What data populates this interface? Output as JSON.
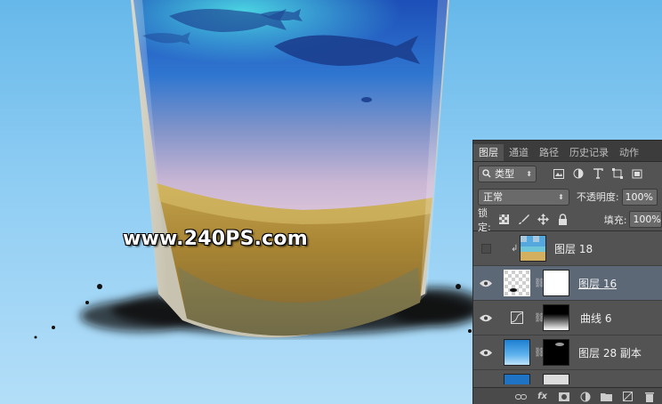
{
  "watermark": "www.240PS.com",
  "colors": {
    "panel_bg": "#535353",
    "tab_bar": "#3c3c3c",
    "selected_row": "#5d6877",
    "sky": "#8fcdf3"
  },
  "panel": {
    "tabs": [
      {
        "label": "图层",
        "active": true
      },
      {
        "label": "通道",
        "active": false
      },
      {
        "label": "路径",
        "active": false
      },
      {
        "label": "历史记录",
        "active": false
      },
      {
        "label": "动作",
        "active": false
      }
    ],
    "filter": {
      "kind_label": "类型",
      "icons": [
        "image-filter-icon",
        "adjustment-filter-icon",
        "type-filter-icon",
        "shape-filter-icon",
        "smart-object-filter-icon"
      ]
    },
    "blend": {
      "mode": "正常",
      "opacity_label": "不透明度:",
      "opacity": "100%"
    },
    "lock": {
      "label": "锁定:",
      "fill_label": "填充:",
      "fill": "100%",
      "icons": [
        "lock-transparent-icon",
        "lock-paint-icon",
        "lock-position-icon",
        "lock-all-icon"
      ]
    },
    "layers": [
      {
        "name": "图层 18",
        "visible": false,
        "clipped": true,
        "selected": false,
        "thumb": "beach",
        "mask": false
      },
      {
        "name": "图层 16",
        "visible": true,
        "clipped": false,
        "selected": true,
        "thumb": "transparent",
        "mask": "white"
      },
      {
        "name": "曲线 6",
        "visible": true,
        "clipped": false,
        "selected": false,
        "thumb": "curves",
        "mask": "gradient"
      },
      {
        "name": "图层 28 副本",
        "visible": true,
        "clipped": false,
        "selected": false,
        "thumb": "sky",
        "mask": "black"
      }
    ],
    "footer_icons": [
      "link-layers-icon",
      "fx-icon",
      "add-mask-icon",
      "adjustment-layer-icon",
      "new-group-icon",
      "new-layer-icon",
      "delete-layer-icon"
    ],
    "fx_label": "fx"
  }
}
